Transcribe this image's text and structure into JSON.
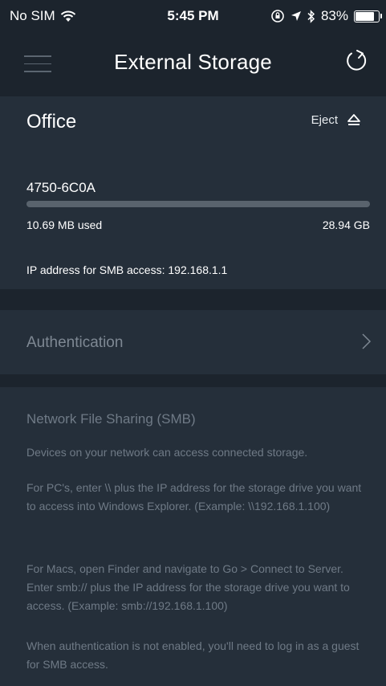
{
  "status_bar": {
    "carrier": "No SIM",
    "time": "5:45 PM",
    "battery": "83%",
    "battery_level": 0.83
  },
  "header": {
    "title": "External Storage"
  },
  "storage": {
    "location": "Office",
    "eject_label": "Eject",
    "drive_name": "4750-6C0A",
    "used_label": "10.69 MB used",
    "total_label": "28.94 GB",
    "usage_fraction": 0.0,
    "ip_label": "IP address for SMB access: 192.168.1.1"
  },
  "authentication": {
    "label": "Authentication"
  },
  "smb_info": {
    "title": "Network File Sharing (SMB)",
    "paragraphs": [
      "Devices on your network can access connected storage.",
      "For PC's, enter \\\\ plus the IP address for the storage drive you want to access into Windows Explorer. (Example: \\\\192.168.1.100)",
      "For Macs, open Finder and navigate to Go > Connect to Server. Enter smb:// plus the IP address for the storage drive you want to access. (Example: smb://192.168.1.100)",
      "When authentication is not enabled, you'll need to log in as a guest for SMB access."
    ]
  },
  "colors": {
    "background": "#1c242d",
    "card": "#252f3a",
    "muted_text": "#6f7a86"
  }
}
